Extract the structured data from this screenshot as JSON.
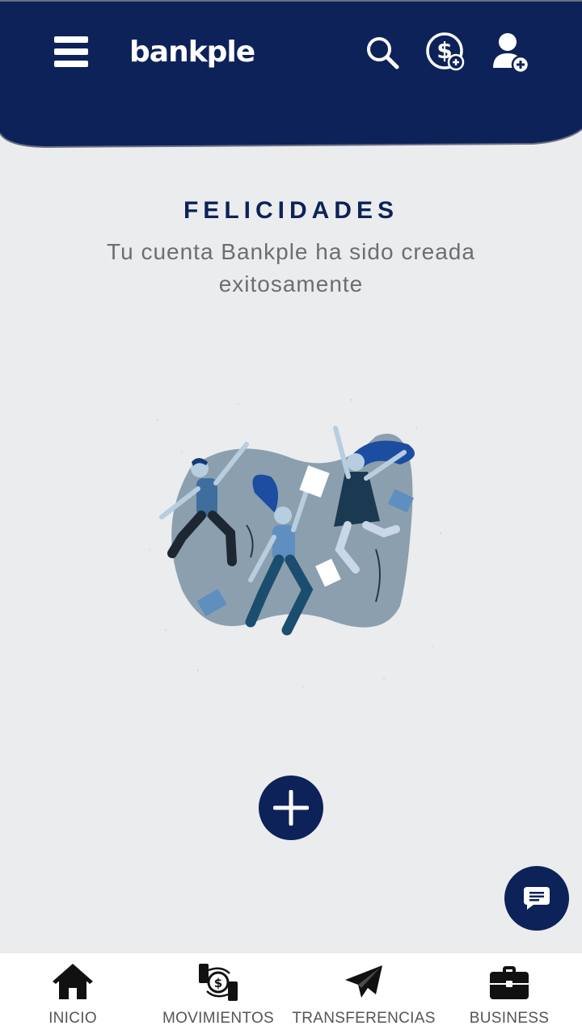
{
  "header": {
    "brand": "bankple",
    "bg_color": "#0d2259"
  },
  "main": {
    "title": "FELICIDADES",
    "subtitle": "Tu cuenta Bankple ha sido creada exitosamente"
  },
  "icons": {
    "menu": "hamburger-icon",
    "search": "search-icon",
    "dollar": "dollar-add-icon",
    "user": "user-add-icon",
    "add": "plus-icon",
    "chat": "chat-icon"
  },
  "bottom_nav": {
    "items": [
      {
        "label": "INICIO",
        "icon": "home-icon"
      },
      {
        "label": "MOVIMIENTOS",
        "icon": "money-exchange-icon"
      },
      {
        "label": "TRANSFERENCIAS",
        "icon": "paper-plane-icon"
      },
      {
        "label": "BUSINESS",
        "icon": "briefcase-icon"
      }
    ]
  },
  "colors": {
    "primary": "#0d2259",
    "background": "#ebecee",
    "nav_bg": "#ffffff"
  }
}
